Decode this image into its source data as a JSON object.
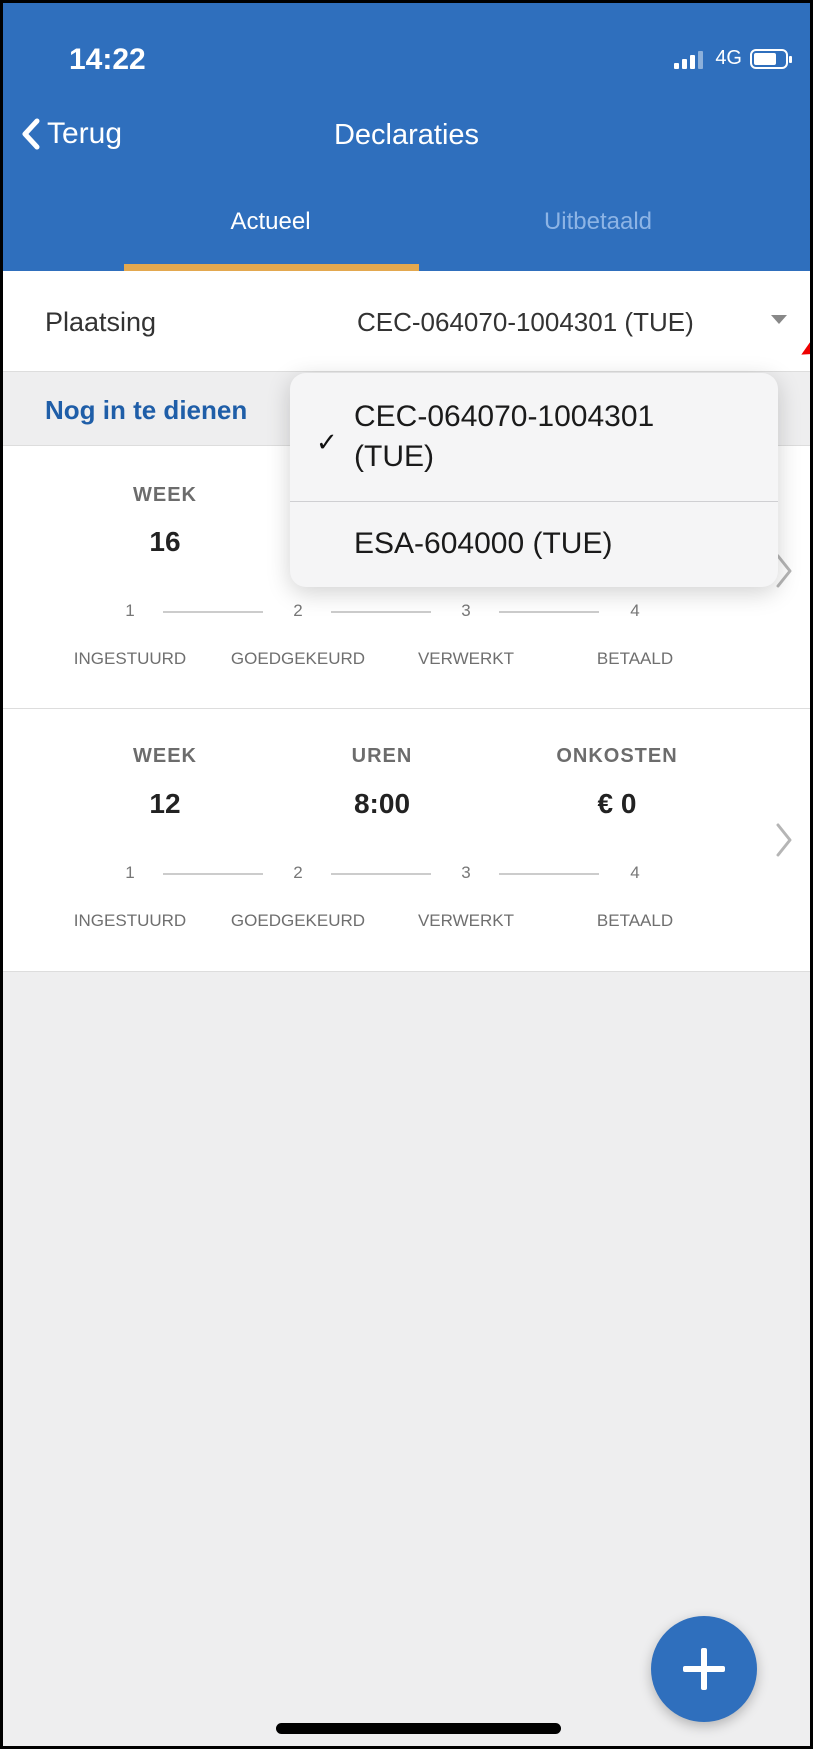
{
  "status": {
    "time": "14:22",
    "network": "4G"
  },
  "nav": {
    "back_label": "Terug",
    "title": "Declaraties"
  },
  "tabs": [
    {
      "label": "Actueel",
      "active": true
    },
    {
      "label": "Uitbetaald",
      "active": false
    }
  ],
  "plaatsing": {
    "label": "Plaatsing",
    "value": "CEC-064070-1004301 (TUE)"
  },
  "section": {
    "title": "Nog in te dienen"
  },
  "columns": {
    "week": "WEEK",
    "hours": "UREN",
    "expenses": "ONKOSTEN"
  },
  "steps": {
    "numbers": [
      "1",
      "2",
      "3",
      "4"
    ],
    "labels": [
      "INGESTUURD",
      "GOEDGEKEURD",
      "VERWERKT",
      "BETAALD"
    ]
  },
  "cards": [
    {
      "week": "16",
      "hours": "",
      "expenses": ""
    },
    {
      "week": "12",
      "hours": "8:00",
      "expenses": "€ 0"
    }
  ],
  "dropdown": {
    "options": [
      {
        "line1": "CEC-064070-1004301",
        "line2": "(TUE)",
        "selected": true
      },
      {
        "line1": "ESA-604000 (TUE)",
        "selected": false
      }
    ]
  },
  "colors": {
    "primary": "#2f6fbd",
    "accent": "#e3a84f",
    "link": "#1f5ea8"
  },
  "icons": {
    "back": "chevron-left-icon",
    "row": "chevron-right-icon",
    "add": "plus-icon"
  }
}
